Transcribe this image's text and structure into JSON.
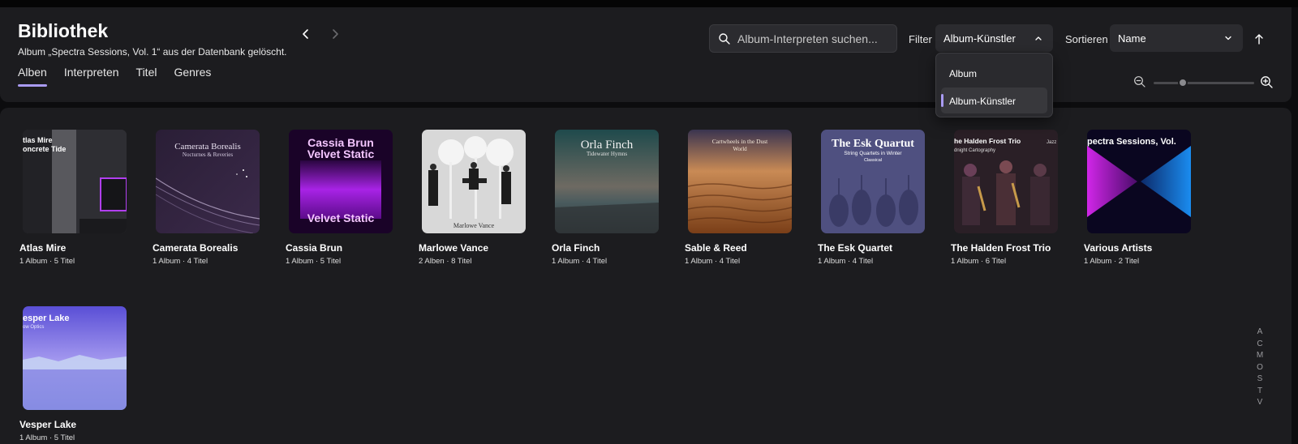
{
  "header": {
    "title": "Bibliothek",
    "status_message": "Album „Spectra Sessions, Vol. 1“ aus der Datenbank gelöscht."
  },
  "tabs": [
    {
      "label": "Alben",
      "active": true
    },
    {
      "label": "Interpreten",
      "active": false
    },
    {
      "label": "Titel",
      "active": false
    },
    {
      "label": "Genres",
      "active": false
    }
  ],
  "search": {
    "placeholder": "Album-Interpreten suchen...",
    "value": ""
  },
  "filter": {
    "label": "Filter",
    "selected": "Album-Künstler",
    "options": [
      "Album",
      "Album-Künstler"
    ]
  },
  "sort": {
    "label": "Sortieren",
    "selected": "Name",
    "direction_icon": "arrow-up-icon"
  },
  "zoom": {
    "level": 0.3
  },
  "colors": {
    "accent": "#a99bf2",
    "panel": "#1c1c1f",
    "background": "#0c0c0e"
  },
  "artists": [
    {
      "name": "Atlas Mire",
      "meta": "1 Album · 5 Titel",
      "cover_text": [
        "tlas Mire",
        "oncrete Tide"
      ]
    },
    {
      "name": "Camerata Borealis",
      "meta": "1 Album · 4 Titel",
      "cover_text": [
        "Camerata Borealis",
        "Nocturnes & Reveries"
      ]
    },
    {
      "name": "Cassia Brun",
      "meta": "1 Album · 5 Titel",
      "cover_text": [
        "Cassia Brun",
        "Velvet Static",
        "Velvet Static"
      ]
    },
    {
      "name": "Marlowe Vance",
      "meta": "2 Alben · 8 Titel",
      "cover_text": [
        "Marlowe Vance"
      ]
    },
    {
      "name": "Orla Finch",
      "meta": "1 Album · 4 Titel",
      "cover_text": [
        "Orla Finch",
        "Tidewater Hymns"
      ]
    },
    {
      "name": "Sable & Reed",
      "meta": "1 Album · 4 Titel",
      "cover_text": [
        "Cartwheels in the Dust",
        "World"
      ]
    },
    {
      "name": "The Esk Quartet",
      "meta": "1 Album · 4 Titel",
      "cover_text": [
        "The Esk Quartut",
        "String Quartets in Winter",
        "Classical"
      ]
    },
    {
      "name": "The Halden Frost Trio",
      "meta": "1 Album · 6 Titel",
      "cover_text": [
        "he Halden Frost Trio",
        "Jazz",
        "dnight Cartography"
      ]
    },
    {
      "name": "Various Artists",
      "meta": "1 Album · 2 Titel",
      "cover_text": [
        "pectra Sessions, Vol."
      ]
    },
    {
      "name": "Vesper Lake",
      "meta": "1 Album · 5 Titel",
      "cover_text": [
        "esper Lake",
        "ow Optics"
      ]
    }
  ],
  "alpha_index": [
    "A",
    "C",
    "M",
    "O",
    "S",
    "T",
    "V"
  ]
}
